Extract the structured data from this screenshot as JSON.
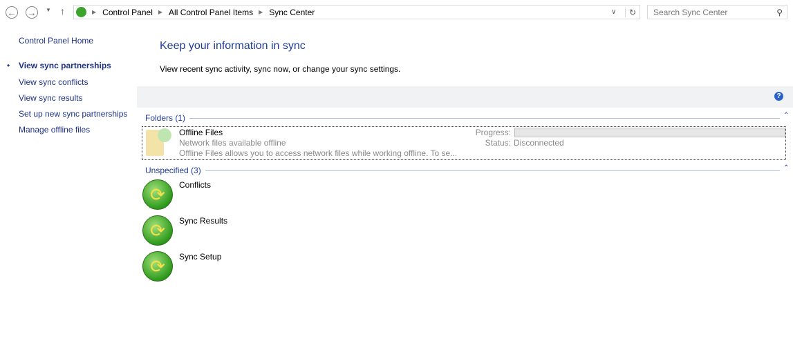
{
  "nav": {
    "breadcrumb": [
      "Control Panel",
      "All Control Panel Items",
      "Sync Center"
    ],
    "search_placeholder": "Search Sync Center"
  },
  "sidebar": {
    "home": "Control Panel Home",
    "items": [
      "View sync partnerships",
      "View sync conflicts",
      "View sync results",
      "Set up new sync partnerships",
      "Manage offline files"
    ]
  },
  "main": {
    "title": "Keep your information in sync",
    "subtitle": "View recent sync activity, sync now, or change your sync settings.",
    "groups": [
      {
        "header": "Folders (1)"
      },
      {
        "header": "Unspecified (3)"
      }
    ],
    "offline": {
      "name": "Offline Files",
      "line1": "Network files available offline",
      "line2": "Offline Files allows you to access network files while working offline. To se...",
      "progress_label": "Progress:",
      "status_label": "Status:",
      "status": "Disconnected",
      "progress": 0
    },
    "items": [
      "Conflicts",
      "Sync Results",
      "Sync Setup"
    ]
  }
}
